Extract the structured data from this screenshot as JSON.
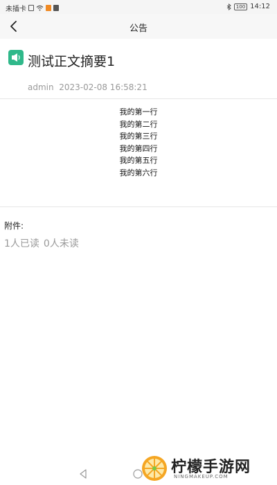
{
  "status_bar": {
    "carrier": "未插卡",
    "time": "14:12",
    "battery": "100",
    "icons": [
      "sim-icon",
      "wifi-icon",
      "app-icon",
      "app-icon",
      "bluetooth-icon",
      "battery-icon"
    ]
  },
  "nav": {
    "title": "公告",
    "back_icon": "chevron-left-icon"
  },
  "notice": {
    "icon": "megaphone-icon",
    "title": "测试正文摘要1",
    "author": "admin",
    "datetime": "2023-02-08 16:58:21",
    "body_lines": [
      "我的第一行",
      "我的第二行",
      "我的第三行",
      "我的第四行",
      "我的第五行",
      "我的第六行"
    ],
    "attachment_label": "附件:",
    "read_count": "1人已读",
    "unread_count": "0人未读"
  },
  "watermark": {
    "text": "柠檬手游网",
    "subtext": "NINGMAKEUP.COM"
  },
  "colors": {
    "accent": "#2fb88a",
    "meta_text": "#999999",
    "nav_bg": "#f7f7f7"
  }
}
